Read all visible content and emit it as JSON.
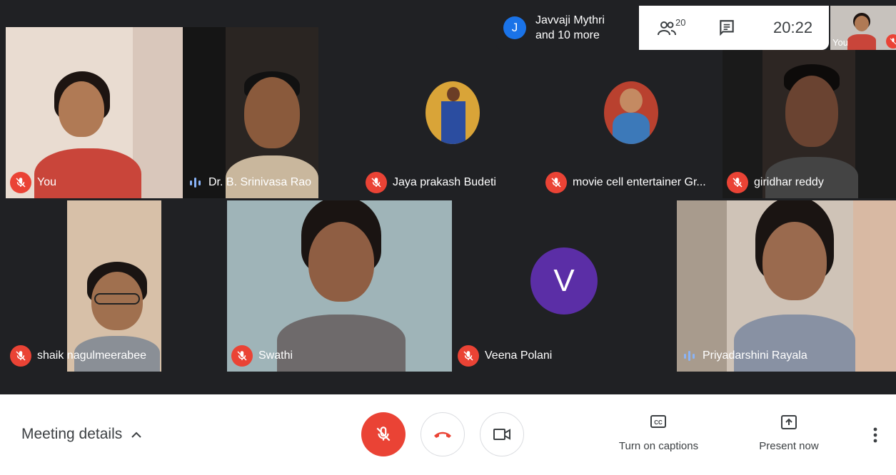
{
  "top_bar": {
    "joined_initial": "J",
    "joined_line1": "Javvaji Mythri",
    "joined_line2": "and 10 more",
    "participant_count": "20",
    "clock": "20:22",
    "self_label": "You"
  },
  "tiles": [
    {
      "name": "You",
      "mic": "off"
    },
    {
      "name": "Dr. B. Srinivasa Rao",
      "mic": "speaking"
    },
    {
      "name": "Jaya prakash Budeti",
      "mic": "off"
    },
    {
      "name": "movie cell entertainer Gr...",
      "mic": "off"
    },
    {
      "name": "giridhar reddy",
      "mic": "off"
    },
    {
      "name": "shaik nagulmeerabee",
      "mic": "off"
    },
    {
      "name": "Swathi",
      "mic": "off"
    },
    {
      "name": "Veena Polani",
      "mic": "off",
      "initial": "V"
    },
    {
      "name": "Priyadarshini Rayala",
      "mic": "speaking"
    }
  ],
  "bottom_bar": {
    "meeting_details": "Meeting details",
    "captions_label": "Turn on captions",
    "present_label": "Present now"
  },
  "colors": {
    "stage": "#202124",
    "mic_off": "#ea4335",
    "veena_avatar": "#5b2ea6",
    "chip_blue": "#1a73e8"
  }
}
